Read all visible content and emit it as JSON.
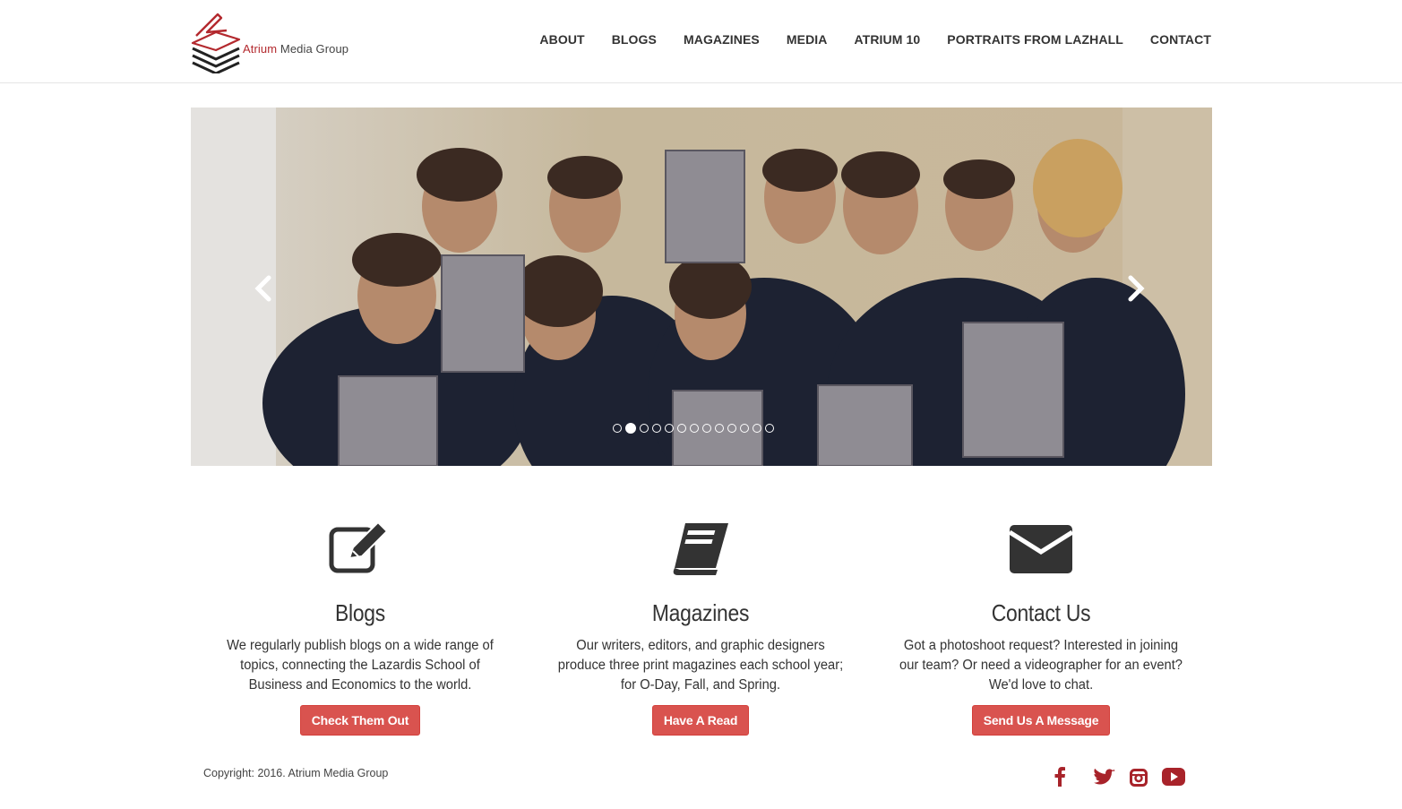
{
  "brand": {
    "name_accent": "Atrium",
    "name_rest": " Media Group"
  },
  "nav": [
    {
      "label": "ABOUT"
    },
    {
      "label": "BLOGS"
    },
    {
      "label": "MAGAZINES"
    },
    {
      "label": "MEDIA"
    },
    {
      "label": "ATRIUM 10"
    },
    {
      "label": "PORTRAITS FROM LAZHALL"
    },
    {
      "label": "CONTACT"
    }
  ],
  "carousel": {
    "slide_count": 13,
    "active_index": 1,
    "prev_icon": "chevron-left-icon",
    "next_icon": "chevron-right-icon"
  },
  "features": [
    {
      "icon": "edit-icon",
      "title": "Blogs",
      "text": "We regularly publish blogs on a wide range of topics, connecting the Lazardis School of Business and Economics to the world.",
      "button": "Check Them Out"
    },
    {
      "icon": "book-icon",
      "title": "Magazines",
      "text": "Our writers, editors, and graphic designers produce three print magazines each school year; for O-Day, Fall, and Spring.",
      "button": "Have A Read"
    },
    {
      "icon": "envelope-icon",
      "title": "Contact Us",
      "text": "Got a photoshoot request? Interested in joining our team? Or need a videographer for an event? We'd love to chat.",
      "button": "Send Us A Message"
    }
  ],
  "footer": {
    "copyright": "Copyright: 2016. Atrium Media Group",
    "social": [
      "facebook-icon",
      "twitter-icon",
      "instagram-icon",
      "youtube-icon"
    ]
  },
  "colors": {
    "accent": "#d9534f",
    "brand_red": "#b3292e",
    "social": "#a8232a"
  }
}
